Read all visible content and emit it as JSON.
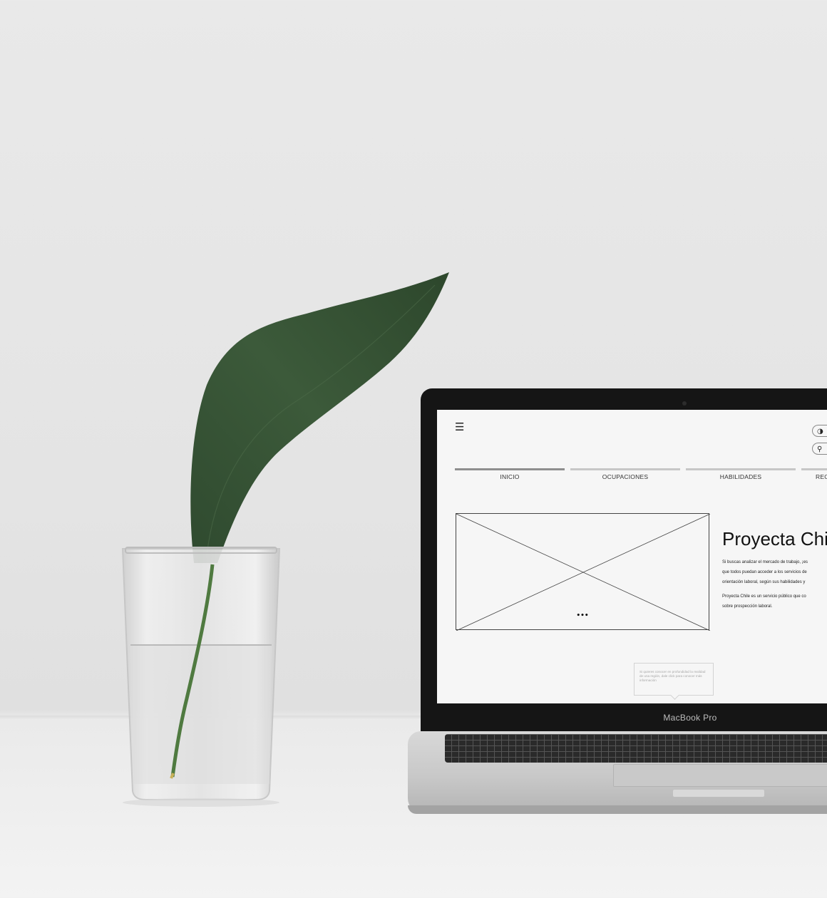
{
  "laptop": {
    "brand_label": "MacBook Pro"
  },
  "site": {
    "menu_icon": "hamburger-icon",
    "theme_toggle_icon": "moon-icon",
    "search_icon": "search-icon",
    "nav": [
      {
        "label": "INICIO",
        "active": true
      },
      {
        "label": "OCUPACIONES",
        "active": false
      },
      {
        "label": "HABILIDADES",
        "active": false
      },
      {
        "label": "REG",
        "active": false
      }
    ],
    "hero": {
      "title": "Proyecta Chil",
      "dots": "•••",
      "lines": [
        "Si buscas analizar el mercado de trabajo, ¡es",
        "que todos puedan acceder a los servicios de",
        "orientación laboral, según sus habilidades y"
      ],
      "paragraph2_lines": [
        "Proyecta Chile es un servicio público que co",
        "sobre prospección laboral."
      ]
    },
    "tooltip": {
      "text": "Si quieres conocer en profundidad la realidad de una región, dale click para conocer más información"
    }
  }
}
